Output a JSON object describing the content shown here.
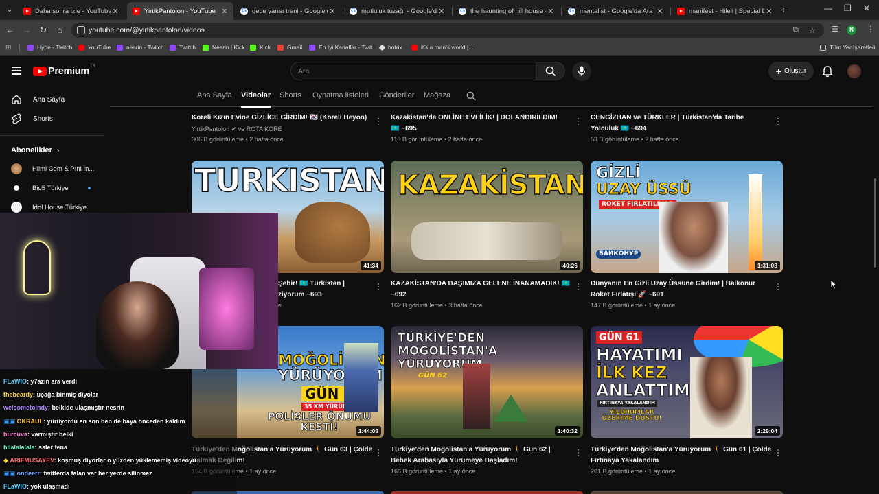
{
  "browser": {
    "tabs": [
      {
        "title": "Daha sonra izle - YouTube",
        "icon": "youtube"
      },
      {
        "title": "YirtikPantolon - YouTube",
        "icon": "youtube"
      },
      {
        "title": "gece yarısı treni - Google'da Ara",
        "icon": "google"
      },
      {
        "title": "mutluluk tuzağı - Google'da Ara",
        "icon": "google"
      },
      {
        "title": "the haunting of hill house - Goo",
        "icon": "google"
      },
      {
        "title": "mentalist - Google'da Ara",
        "icon": "google"
      },
      {
        "title": "manifest - Hileli | Special Dance",
        "icon": "youtube"
      }
    ],
    "url": "youtube.com/@yirtikpantolon/videos",
    "profile_initial": "N",
    "bookmarks": [
      "Hype - Twitch",
      "YouTube",
      "nesrin - Twitch",
      "Twitch",
      "Nesrin | Kick",
      "Kick",
      "Gmail",
      "En İyi Kanallar - Twit...",
      "botrix",
      "it's a man's world |..."
    ],
    "all_bookmarks": "Tüm Yer İşaretleri"
  },
  "youtube": {
    "brand": "Premium",
    "country": "TR",
    "search_placeholder": "Ara",
    "create_label": "Oluştur"
  },
  "sidebar": {
    "home": "Ana Sayfa",
    "shorts": "Shorts",
    "subscriptions_heading": "Abonelikler",
    "subscriptions": [
      "Hilmi Cem & Pınl İn...",
      "Big5 Türkiye",
      "Idol House Türkiye"
    ]
  },
  "channel_tabs": [
    "Ana Sayfa",
    "Videolar",
    "Shorts",
    "Oynatma listeleri",
    "Gönderiler",
    "Mağaza"
  ],
  "videos": {
    "row0": [
      {
        "title": "Koreli Kızın Evine GİZLİCE GİRDİM! 🇰🇷 (Koreli Heyon)",
        "channel": "YirtikPantolon ✔ ve ROTA KORE",
        "meta": "306 B görüntüleme • 2 hafta önce"
      },
      {
        "title": "Kazakistan'da ONLİNE EVLİLİK! | DOLANDIRILDIM! 🇰🇿 ~695",
        "meta": "113 B görüntüleme • 2 hafta önce"
      },
      {
        "title": "CENGİZHAN ve TÜRKLER | Türkistan'da Tarihe Yolculuk 🇰🇿 ~694",
        "meta": "53 B görüntüleme • 2 hafta önce"
      }
    ],
    "row1": [
      {
        "title": "Şehir! 🇰🇿 Türkistan |",
        "title2": "ziyorum ~693",
        "meta": "e",
        "duration": "41:34",
        "thumb_text": "TURKISTAN"
      },
      {
        "title": "KAZAKİSTAN'DA BAŞIMIZA GELENE İNANAMADIK! 🇰🇿 ~692",
        "meta": "162 B görüntüleme • 3 hafta önce",
        "duration": "40:26",
        "thumb_text": "KAZAKİSTAN"
      },
      {
        "title": "Dünyanın En Gizli Uzay Üssüne Girdim! | Baikonur Roket Fırlatışı 🚀 ~691",
        "meta": "147 B görüntüleme • 1 ay önce",
        "duration": "1:31:08",
        "thumb_text": [
          "GİZLİ",
          "UZAY ÜSSÜ",
          "ROKET FIRLATILIYOR",
          "БАЙКОНУР"
        ]
      }
    ],
    "row2": [
      {
        "title": "Türkiye'den Moğolistan'a Yürüyorum 🚶 Gün 63 | Çölde Kalmak Değilim!",
        "meta": "154 B görüntüleme • 1 ay önce",
        "duration": "1:44:09",
        "thumb_text": [
          "MOĞOLİSTAN'A",
          "YÜRÜYORUM",
          "GÜN 63",
          "35 KM YÜRÜDÜM",
          "POLİSLER ÖNÜMÜ KESTİ!"
        ]
      },
      {
        "title": "Türkiye'den Moğolistan'a Yürüyorum 🚶 Gün 62 | Bebek Arabasıyla Yürümeye Başladım!",
        "meta": "166 B görüntüleme • 1 ay önce",
        "duration": "1:40:32",
        "thumb_text": [
          "TÜRKİYE'DEN",
          "MOĞOLİSTAN'A",
          "YÜRÜYORUM",
          "GÜN 62"
        ]
      },
      {
        "title": "Türkiye'den Moğolistan'a Yürüyorum 🚶 Gün 61 | Çölde Fırtınaya Yakalandım",
        "meta": "201 B görüntüleme • 1 ay önce",
        "duration": "2:29:04",
        "thumb_text": [
          "GÜN 61",
          "HAYATIMI",
          "İLK KEZ",
          "ANLATTIM!",
          "FIRTINAYA YAKALANDIM",
          "YILDIRIMLAR ÜZERİME DÜŞTÜ!"
        ]
      }
    ]
  },
  "chat": [
    {
      "user": "FLaWIO",
      "msg": ": y7azın ara verdi",
      "color": "#5bd0ff"
    },
    {
      "user": "thebeardy",
      "msg": ": uçağa binmiş diyolar",
      "color": "#ffd84a"
    },
    {
      "user": "welcometoindy",
      "msg": ": belkide ulaşmıştır nesrin",
      "color": "#b38cff"
    },
    {
      "user": "OKRAUL",
      "msg": ": yürüyordu en son ben de baya önceden kaldım",
      "color": "#ffc94a"
    },
    {
      "user": "burcuva",
      "msg": ": varmıştır belki",
      "color": "#ff8ad8"
    },
    {
      "user": "hilalalalala",
      "msg": ": ssler fena",
      "color": "#6ef0c8"
    },
    {
      "user": "ARIFMUSAYEV",
      "msg": ": koşmuş diyorlar o yüzden yüklememiş videoyu",
      "color": "#ff6a6a"
    },
    {
      "user": "ondeerr",
      "msg": ": twitterda falan var her yerde silinmez",
      "color": "#7aa6ff"
    },
    {
      "user": "FLaWIO",
      "msg": ": yok ulaşmadı",
      "color": "#5bd0ff"
    }
  ],
  "colors": {
    "accent": "#ff0000",
    "background": "#0f0f0f",
    "link": "#3ea6ff"
  }
}
